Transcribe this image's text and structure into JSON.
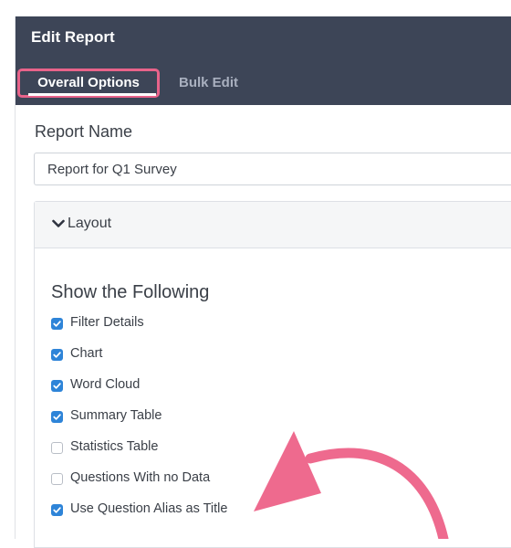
{
  "header": {
    "title": "Edit Report",
    "tabs": [
      {
        "label": "Overall Options",
        "active": true
      },
      {
        "label": "Bulk Edit",
        "active": false
      }
    ]
  },
  "report_name": {
    "label": "Report Name",
    "value": "Report for Q1 Survey"
  },
  "layout": {
    "section_label": "Layout",
    "show_title": "Show the Following",
    "options": [
      {
        "label": "Filter Details",
        "checked": true
      },
      {
        "label": "Chart",
        "checked": true
      },
      {
        "label": "Word Cloud",
        "checked": true
      },
      {
        "label": "Summary Table",
        "checked": true
      },
      {
        "label": "Statistics Table",
        "checked": false
      },
      {
        "label": "Questions With no Data",
        "checked": false
      },
      {
        "label": "Use Question Alias as Title",
        "checked": true
      }
    ]
  },
  "colors": {
    "header_bg": "#3d4557",
    "highlight": "#e8638a",
    "checkbox": "#2e84d8",
    "annotation_arrow": "#ee6a8e"
  },
  "icons": {
    "section_toggle": "chevron-down-icon",
    "checkbox_mark": "checkmark-icon",
    "annotation": "curved-arrow-icon"
  }
}
